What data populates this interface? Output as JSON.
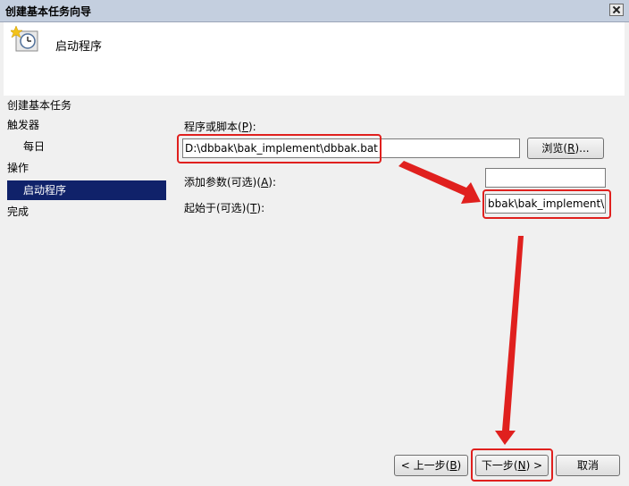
{
  "window": {
    "title": "创建基本任务向导"
  },
  "header": {
    "heading": "启动程序",
    "icon": "clock-task-icon"
  },
  "nav": {
    "items": [
      {
        "label": "创建基本任务"
      },
      {
        "label": "触发器"
      },
      {
        "label": "每日"
      },
      {
        "label": "操作"
      },
      {
        "label": "启动程序"
      },
      {
        "label": "完成"
      }
    ]
  },
  "form": {
    "program_label": "程序或脚本",
    "program_hotkey": "P",
    "program_value": "D:\\dbbak\\bak_implement\\dbbak.bat",
    "browse_label": "浏览",
    "browse_hotkey": "R",
    "args_label": "添加参数(可选)",
    "args_hotkey": "A",
    "args_value": "",
    "start_label": "起始于(可选)",
    "start_hotkey": "T",
    "start_value": "bbak\\bak_implement\\"
  },
  "buttons": {
    "back_label": "< 上一步",
    "back_hotkey": "B",
    "next_label": "下一步",
    "next_hotkey": "N",
    "cancel_label": "取消"
  },
  "annotation_color": "#e0201e",
  "selection_color": "#10226a"
}
